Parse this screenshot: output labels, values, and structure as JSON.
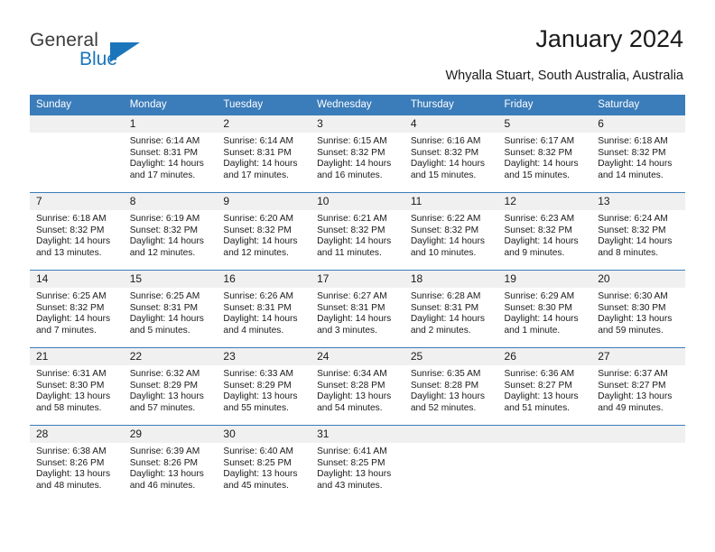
{
  "brand": {
    "name_top": "General",
    "name_bottom": "Blue",
    "accent_color": "#1b75bb"
  },
  "header": {
    "title": "January 2024",
    "subtitle": "Whyalla Stuart, South Australia, Australia",
    "header_bg_color": "#3b7cba",
    "daynum_bg_color": "#f0f0f0"
  },
  "weekday_headers": [
    "Sunday",
    "Monday",
    "Tuesday",
    "Wednesday",
    "Thursday",
    "Friday",
    "Saturday"
  ],
  "weeks": [
    [
      {
        "day": "",
        "sunrise": "",
        "sunset": "",
        "daylight_line1": "",
        "daylight_line2": ""
      },
      {
        "day": "1",
        "sunrise": "Sunrise: 6:14 AM",
        "sunset": "Sunset: 8:31 PM",
        "daylight_line1": "Daylight: 14 hours",
        "daylight_line2": "and 17 minutes."
      },
      {
        "day": "2",
        "sunrise": "Sunrise: 6:14 AM",
        "sunset": "Sunset: 8:31 PM",
        "daylight_line1": "Daylight: 14 hours",
        "daylight_line2": "and 17 minutes."
      },
      {
        "day": "3",
        "sunrise": "Sunrise: 6:15 AM",
        "sunset": "Sunset: 8:32 PM",
        "daylight_line1": "Daylight: 14 hours",
        "daylight_line2": "and 16 minutes."
      },
      {
        "day": "4",
        "sunrise": "Sunrise: 6:16 AM",
        "sunset": "Sunset: 8:32 PM",
        "daylight_line1": "Daylight: 14 hours",
        "daylight_line2": "and 15 minutes."
      },
      {
        "day": "5",
        "sunrise": "Sunrise: 6:17 AM",
        "sunset": "Sunset: 8:32 PM",
        "daylight_line1": "Daylight: 14 hours",
        "daylight_line2": "and 15 minutes."
      },
      {
        "day": "6",
        "sunrise": "Sunrise: 6:18 AM",
        "sunset": "Sunset: 8:32 PM",
        "daylight_line1": "Daylight: 14 hours",
        "daylight_line2": "and 14 minutes."
      }
    ],
    [
      {
        "day": "7",
        "sunrise": "Sunrise: 6:18 AM",
        "sunset": "Sunset: 8:32 PM",
        "daylight_line1": "Daylight: 14 hours",
        "daylight_line2": "and 13 minutes."
      },
      {
        "day": "8",
        "sunrise": "Sunrise: 6:19 AM",
        "sunset": "Sunset: 8:32 PM",
        "daylight_line1": "Daylight: 14 hours",
        "daylight_line2": "and 12 minutes."
      },
      {
        "day": "9",
        "sunrise": "Sunrise: 6:20 AM",
        "sunset": "Sunset: 8:32 PM",
        "daylight_line1": "Daylight: 14 hours",
        "daylight_line2": "and 12 minutes."
      },
      {
        "day": "10",
        "sunrise": "Sunrise: 6:21 AM",
        "sunset": "Sunset: 8:32 PM",
        "daylight_line1": "Daylight: 14 hours",
        "daylight_line2": "and 11 minutes."
      },
      {
        "day": "11",
        "sunrise": "Sunrise: 6:22 AM",
        "sunset": "Sunset: 8:32 PM",
        "daylight_line1": "Daylight: 14 hours",
        "daylight_line2": "and 10 minutes."
      },
      {
        "day": "12",
        "sunrise": "Sunrise: 6:23 AM",
        "sunset": "Sunset: 8:32 PM",
        "daylight_line1": "Daylight: 14 hours",
        "daylight_line2": "and 9 minutes."
      },
      {
        "day": "13",
        "sunrise": "Sunrise: 6:24 AM",
        "sunset": "Sunset: 8:32 PM",
        "daylight_line1": "Daylight: 14 hours",
        "daylight_line2": "and 8 minutes."
      }
    ],
    [
      {
        "day": "14",
        "sunrise": "Sunrise: 6:25 AM",
        "sunset": "Sunset: 8:32 PM",
        "daylight_line1": "Daylight: 14 hours",
        "daylight_line2": "and 7 minutes."
      },
      {
        "day": "15",
        "sunrise": "Sunrise: 6:25 AM",
        "sunset": "Sunset: 8:31 PM",
        "daylight_line1": "Daylight: 14 hours",
        "daylight_line2": "and 5 minutes."
      },
      {
        "day": "16",
        "sunrise": "Sunrise: 6:26 AM",
        "sunset": "Sunset: 8:31 PM",
        "daylight_line1": "Daylight: 14 hours",
        "daylight_line2": "and 4 minutes."
      },
      {
        "day": "17",
        "sunrise": "Sunrise: 6:27 AM",
        "sunset": "Sunset: 8:31 PM",
        "daylight_line1": "Daylight: 14 hours",
        "daylight_line2": "and 3 minutes."
      },
      {
        "day": "18",
        "sunrise": "Sunrise: 6:28 AM",
        "sunset": "Sunset: 8:31 PM",
        "daylight_line1": "Daylight: 14 hours",
        "daylight_line2": "and 2 minutes."
      },
      {
        "day": "19",
        "sunrise": "Sunrise: 6:29 AM",
        "sunset": "Sunset: 8:30 PM",
        "daylight_line1": "Daylight: 14 hours",
        "daylight_line2": "and 1 minute."
      },
      {
        "day": "20",
        "sunrise": "Sunrise: 6:30 AM",
        "sunset": "Sunset: 8:30 PM",
        "daylight_line1": "Daylight: 13 hours",
        "daylight_line2": "and 59 minutes."
      }
    ],
    [
      {
        "day": "21",
        "sunrise": "Sunrise: 6:31 AM",
        "sunset": "Sunset: 8:30 PM",
        "daylight_line1": "Daylight: 13 hours",
        "daylight_line2": "and 58 minutes."
      },
      {
        "day": "22",
        "sunrise": "Sunrise: 6:32 AM",
        "sunset": "Sunset: 8:29 PM",
        "daylight_line1": "Daylight: 13 hours",
        "daylight_line2": "and 57 minutes."
      },
      {
        "day": "23",
        "sunrise": "Sunrise: 6:33 AM",
        "sunset": "Sunset: 8:29 PM",
        "daylight_line1": "Daylight: 13 hours",
        "daylight_line2": "and 55 minutes."
      },
      {
        "day": "24",
        "sunrise": "Sunrise: 6:34 AM",
        "sunset": "Sunset: 8:28 PM",
        "daylight_line1": "Daylight: 13 hours",
        "daylight_line2": "and 54 minutes."
      },
      {
        "day": "25",
        "sunrise": "Sunrise: 6:35 AM",
        "sunset": "Sunset: 8:28 PM",
        "daylight_line1": "Daylight: 13 hours",
        "daylight_line2": "and 52 minutes."
      },
      {
        "day": "26",
        "sunrise": "Sunrise: 6:36 AM",
        "sunset": "Sunset: 8:27 PM",
        "daylight_line1": "Daylight: 13 hours",
        "daylight_line2": "and 51 minutes."
      },
      {
        "day": "27",
        "sunrise": "Sunrise: 6:37 AM",
        "sunset": "Sunset: 8:27 PM",
        "daylight_line1": "Daylight: 13 hours",
        "daylight_line2": "and 49 minutes."
      }
    ],
    [
      {
        "day": "28",
        "sunrise": "Sunrise: 6:38 AM",
        "sunset": "Sunset: 8:26 PM",
        "daylight_line1": "Daylight: 13 hours",
        "daylight_line2": "and 48 minutes."
      },
      {
        "day": "29",
        "sunrise": "Sunrise: 6:39 AM",
        "sunset": "Sunset: 8:26 PM",
        "daylight_line1": "Daylight: 13 hours",
        "daylight_line2": "and 46 minutes."
      },
      {
        "day": "30",
        "sunrise": "Sunrise: 6:40 AM",
        "sunset": "Sunset: 8:25 PM",
        "daylight_line1": "Daylight: 13 hours",
        "daylight_line2": "and 45 minutes."
      },
      {
        "day": "31",
        "sunrise": "Sunrise: 6:41 AM",
        "sunset": "Sunset: 8:25 PM",
        "daylight_line1": "Daylight: 13 hours",
        "daylight_line2": "and 43 minutes."
      },
      {
        "day": "",
        "sunrise": "",
        "sunset": "",
        "daylight_line1": "",
        "daylight_line2": ""
      },
      {
        "day": "",
        "sunrise": "",
        "sunset": "",
        "daylight_line1": "",
        "daylight_line2": ""
      },
      {
        "day": "",
        "sunrise": "",
        "sunset": "",
        "daylight_line1": "",
        "daylight_line2": ""
      }
    ]
  ]
}
